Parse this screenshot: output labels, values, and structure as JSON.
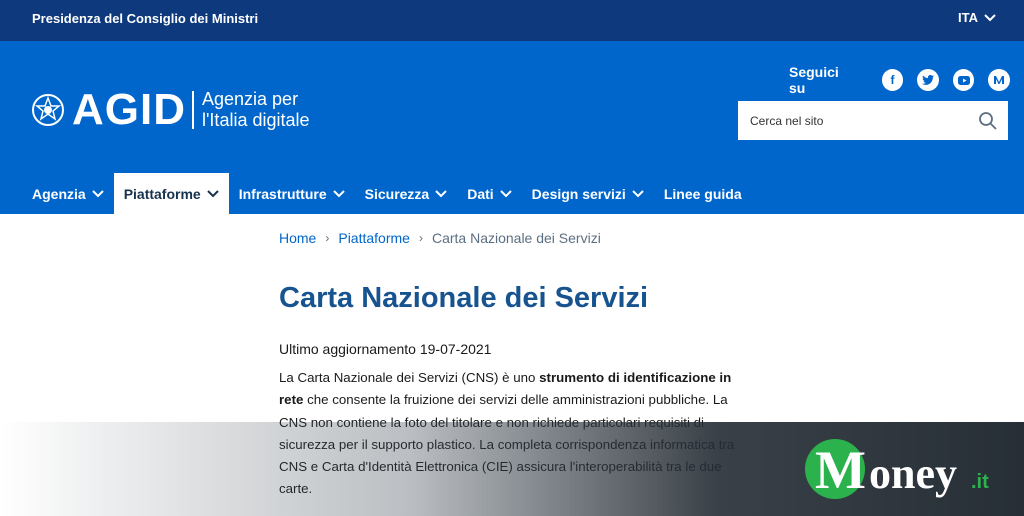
{
  "topbar": {
    "org": "Presidenza del Consiglio dei Ministri",
    "lang": "ITA"
  },
  "logo": {
    "name": "AGID",
    "subtitle_line1": "Agenzia per",
    "subtitle_line2": "l'Italia digitale"
  },
  "social": {
    "label": "Seguici su",
    "icons": [
      "facebook-icon",
      "twitter-icon",
      "youtube-icon",
      "medium-icon"
    ]
  },
  "search": {
    "placeholder": "Cerca nel sito"
  },
  "nav": {
    "items": [
      {
        "label": "Agenzia",
        "dropdown": true
      },
      {
        "label": "Piattaforme",
        "dropdown": true,
        "active": true
      },
      {
        "label": "Infrastrutture",
        "dropdown": true
      },
      {
        "label": "Sicurezza",
        "dropdown": true
      },
      {
        "label": "Dati",
        "dropdown": true
      },
      {
        "label": "Design servizi",
        "dropdown": true
      },
      {
        "label": "Linee guida",
        "dropdown": false
      }
    ]
  },
  "breadcrumb": {
    "home": "Home",
    "section": "Piattaforme",
    "current": "Carta Nazionale dei Servizi"
  },
  "page": {
    "title": "Carta Nazionale dei Servizi",
    "updated": "Ultimo aggiornamento 19-07-2021",
    "p_start": "La Carta Nazionale dei Servizi (CNS) è uno ",
    "p_bold": "strumento di identificazione in rete",
    "p_end": " che consente la fruizione dei servizi delle amministrazioni pubbliche. La CNS non contiene la foto del titolare e non richiede particolari requisiti di sicurezza per il supporto plastico. La completa corrispondenza informatica tra CNS e Carta d'Identità Elettronica (CIE) assicura l'interoperabilità tra le due carte."
  },
  "watermark": {
    "brand_initial": "M",
    "brand_rest": "oney",
    "brand_tld": ".it"
  },
  "colors": {
    "topbar": "#0e3a7d",
    "header": "#0066cc",
    "title": "#17548f",
    "watermark_green": "#2bb24c"
  }
}
